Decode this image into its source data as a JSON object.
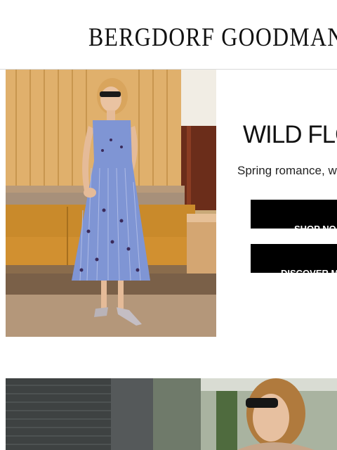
{
  "header": {
    "logo_text": "BERGDORF GOODMAN"
  },
  "hero": {
    "title": "WILD FLO",
    "subtitle": "Spring romance, w",
    "shop_button": "SHOP NO",
    "discover_button": "DISCOVER M"
  },
  "colors": {
    "button_bg": "#000000",
    "button_text": "#ffffff",
    "header_border": "#d9d9d9"
  }
}
